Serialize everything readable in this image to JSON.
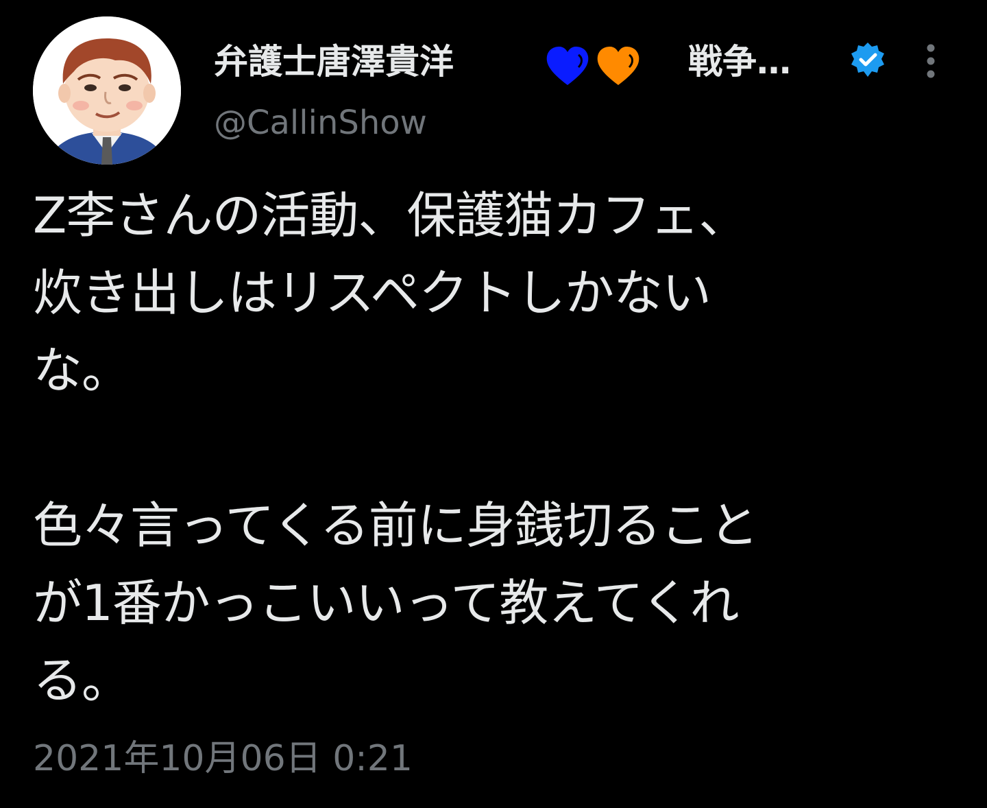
{
  "tweet": {
    "author": {
      "display_name": "弁護士唐澤貴洋",
      "name_suffix": "戦争…",
      "handle": "@CallinShow",
      "avatar_icon": "cartoon-man-portrait-avatar",
      "verified": true,
      "emoji": [
        {
          "name": "blue-heart-icon",
          "color": "#0a1cff"
        },
        {
          "name": "orange-heart-icon",
          "color": "#ff8a00"
        }
      ]
    },
    "more_icon": "vertical-ellipsis-icon",
    "body_lines": [
      "Z李さんの活動、保護猫カフェ、",
      "炊き出しはリスペクトしかない",
      "な。",
      "",
      "色々言ってくる前に身銭切ること",
      "が1番かっこいいって教えてくれ",
      "る。"
    ],
    "timestamp": "2021年10月06日 0:21"
  },
  "colors": {
    "background": "#000000",
    "primary_text": "#e7e9ea",
    "secondary_text": "#71767b",
    "verified_blue": "#1d9bf0"
  }
}
